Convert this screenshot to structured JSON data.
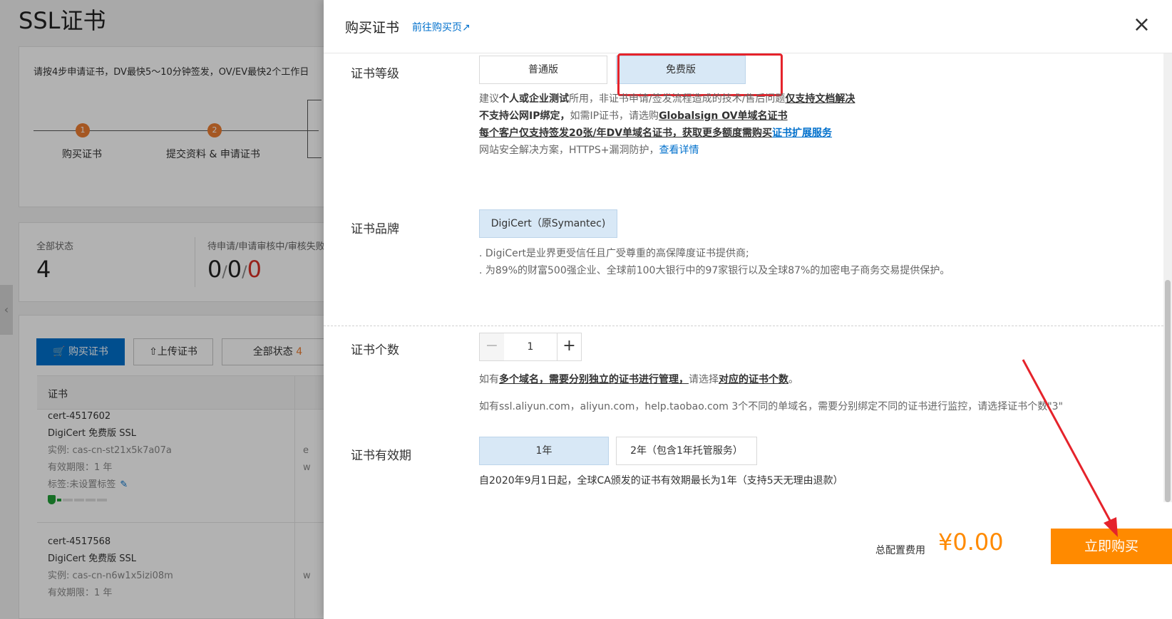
{
  "background": {
    "page_title": "SSL证书",
    "steps_card": {
      "intro": "请按4步申请证书，DV最快5～10分钟签发，OV/EV最快2个工作日",
      "steps": [
        {
          "num": "1",
          "label": "购买证书"
        },
        {
          "num": "2",
          "label": "提交资料 & 申请证书"
        }
      ]
    },
    "status_card": {
      "all_label": "全部状态",
      "all_value": "4",
      "pending_label": "待申请/申请审核中/审核失败",
      "pending_values": [
        "0",
        "0",
        "0"
      ],
      "slash": "/"
    },
    "toolbar": {
      "buy_label": "购买证书",
      "upload_label": "上传证书",
      "status_filter_label": "全部状态",
      "status_filter_count": "4"
    },
    "table": {
      "header": "证书",
      "rows": [
        {
          "name": "cert-4517602",
          "product": "DigiCert 免费版 SSL",
          "instance": "实例: cas-cn-st21x5k7a07a",
          "validity": "有效期限：1 年",
          "tag": "标签:未设置标签",
          "col2_a": "e",
          "col2_b": "w"
        },
        {
          "name": "cert-4517568",
          "product": "DigiCert 免费版 SSL",
          "instance": "实例: cas-cn-n6w1x5izi08m",
          "validity": "有效期限：1 年",
          "col2_b": "w"
        }
      ]
    }
  },
  "drawer": {
    "title": "购买证书",
    "goto_link": "前往购买页",
    "close_symbol": "×",
    "level": {
      "label": "证书等级",
      "options": [
        "普通版",
        "免费版"
      ],
      "selected": "免费版",
      "notes": {
        "line1_a": "建议",
        "line1_b": "个人或企业测试",
        "line1_c": "所用，非证书申请/签发流程造成的技术/售后问题",
        "line1_d": "仅支持文档解决",
        "line2_a": "不支持公网IP绑定，",
        "line2_b": "如需IP证书，请选购",
        "line2_c": "Globalsign OV单域名证书",
        "line3_a": "每个客户仅支持签发20张/年DV单域名证书，获取更多额度需购买",
        "line3_b": "证书扩展服务",
        "line4_a": "网站安全解决方案，HTTPS+漏洞防护，",
        "line4_b": "查看详情"
      }
    },
    "brand": {
      "label": "证书品牌",
      "option": "DigiCert（原Symantec)",
      "note1": ". DigiCert是业界更受信任且广受尊重的高保障度证书提供商;",
      "note2": ". 为89%的财富500强企业、全球前100大银行中的97家银行以及全球87%的加密电子商务交易提供保护。"
    },
    "count": {
      "label": "证书个数",
      "value": "1",
      "minus": "−",
      "plus": "+",
      "note1_a": "如有",
      "note1_b": "多个域名，需要",
      "note1_c": "分别独立的证书进行管理，",
      "note1_d": "请选择",
      "note1_e": "对应的证书个数",
      "note1_f": "。",
      "note2": "如有ssl.aliyun.com，aliyun.com，help.taobao.com 3个不同的单域名，需要分别绑定不同的证书进行监控，请选择证书个数\"3\""
    },
    "validity": {
      "label": "证书有效期",
      "options": [
        "1年",
        "2年（包含1年托管服务）"
      ],
      "selected": "1年",
      "note_partial": "自2020年9月1日起，全球CA颁发的证书有效期最长为1年（支持5天无理由退款）"
    },
    "footer": {
      "total_label": "总配置费用",
      "total_value": "¥0.00",
      "buy_button": "立即购买"
    }
  },
  "colors": {
    "accent_orange": "#ff8a00",
    "link_blue": "#0070cc",
    "selected_bg": "#d8e8f6",
    "annotation_red": "#e5232b"
  }
}
